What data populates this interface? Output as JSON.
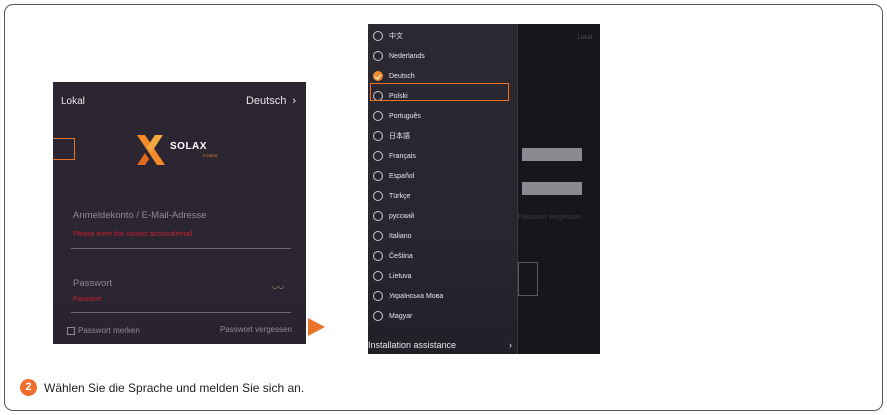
{
  "login_screen": {
    "mode_label": "Lokal",
    "language": "Deutsch",
    "logo_text": "SOLAX",
    "logo_sub": "POWER",
    "account_placeholder": "Anmeldekonto / E-Mail-Adresse",
    "account_error": "Please enter the correct account/email",
    "password_placeholder": "Passwort",
    "password_error": "Passwort",
    "remember_label": "Passwort merken",
    "forgot_label": "Passwort vergessen"
  },
  "language_menu": {
    "background_mode_label": "Lokal",
    "background_forgot": "Passwort vergessen",
    "items": [
      {
        "label": "中文",
        "selected": false
      },
      {
        "label": "Nederlands",
        "selected": false
      },
      {
        "label": "Deutsch",
        "selected": true
      },
      {
        "label": "Polski",
        "selected": false,
        "highlighted": true
      },
      {
        "label": "Português",
        "selected": false
      },
      {
        "label": "日本語",
        "selected": false
      },
      {
        "label": "Français",
        "selected": false
      },
      {
        "label": "Español",
        "selected": false
      },
      {
        "label": "Türkçe",
        "selected": false
      },
      {
        "label": "русский",
        "selected": false
      },
      {
        "label": "Italiano",
        "selected": false
      },
      {
        "label": "Čeština",
        "selected": false
      },
      {
        "label": "Lietuva",
        "selected": false
      },
      {
        "label": "Українська Мова",
        "selected": false
      },
      {
        "label": "Magyar",
        "selected": false
      }
    ],
    "footer_label": "Installation assistance"
  },
  "instruction": {
    "step_number": "2",
    "text": "Wählen Sie die Sprache und melden Sie sich an."
  },
  "colors": {
    "accent": "#e8742a",
    "error": "#c92030"
  }
}
